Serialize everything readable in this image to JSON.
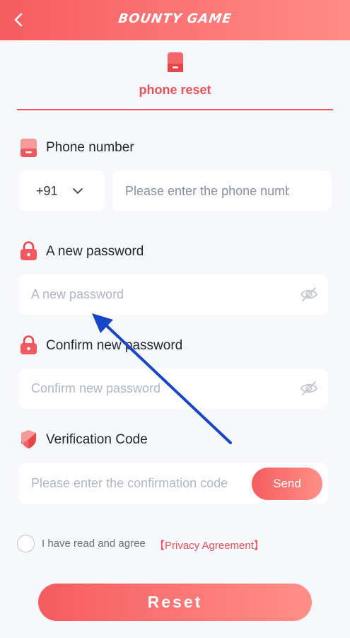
{
  "header": {
    "logo_text": "BOUNTY GAME",
    "back_icon": "chevron-left-icon"
  },
  "tab": {
    "label": "phone reset",
    "icon": "phone-icon"
  },
  "phone": {
    "title": "Phone number",
    "country_code": "+91",
    "placeholder": "Please enter the phone number"
  },
  "new_password": {
    "title": "A new password",
    "placeholder": "A new password"
  },
  "confirm_password": {
    "title": "Confirm new password",
    "placeholder": "Confirm new password"
  },
  "verification": {
    "title": "Verification Code",
    "placeholder": "Please enter the confirmation code",
    "send_label": "Send"
  },
  "agreement": {
    "text": "I have read and agree",
    "link": "【Privacy Agreement】"
  },
  "reset_label": "Reset",
  "colors": {
    "accent": "#f65c60",
    "accent_light": "#ff8c86",
    "arrow": "#1746c7"
  }
}
